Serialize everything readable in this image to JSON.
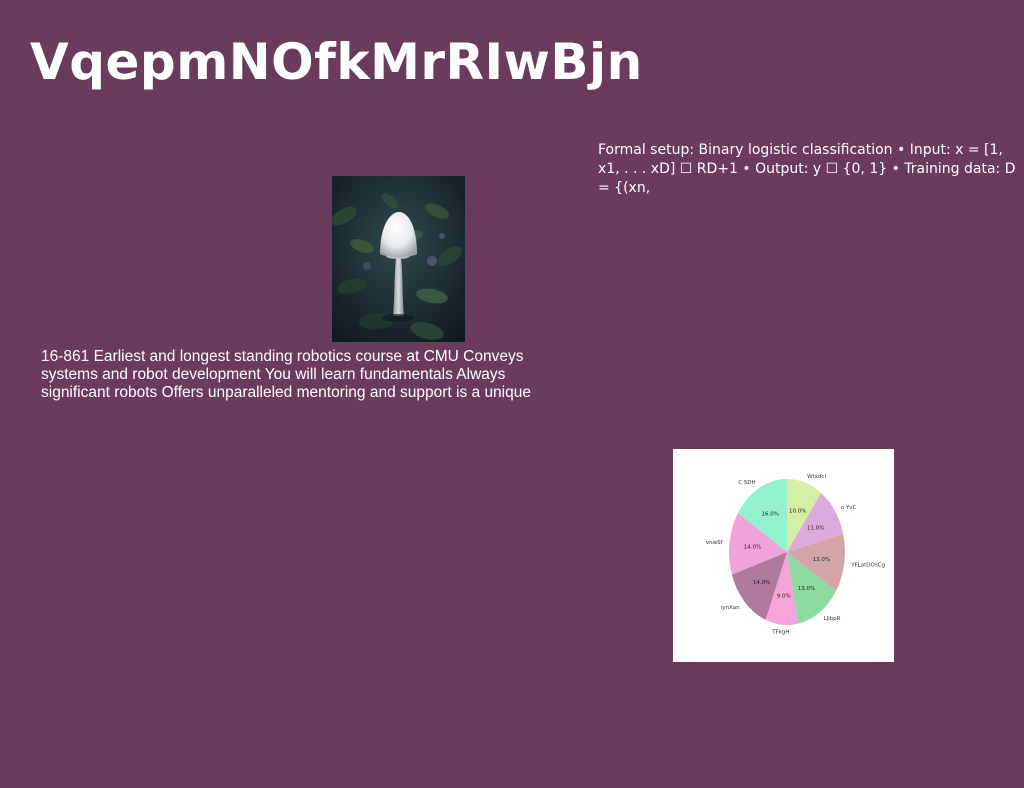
{
  "page": {
    "title": "VqepmNOfkMrRIwBjn",
    "background_color": "#6b3b5b"
  },
  "formal_setup": {
    "text": "Formal setup: Binary logistic classification • Input: x = [1, x1, . . . xD] ☐ RD+1 • Output: y ☐ {0, 1} • Training data: D = {(xn,"
  },
  "photo": {
    "subject": "white mushroom among dark foliage"
  },
  "course_description": {
    "text": "16-861 Earliest and longest standing robotics course at CMU Conveys systems and robot development You will learn fundamentals Always significant robots Offers unparalleled mentoring and support is a unique"
  },
  "chart_data": {
    "type": "pie",
    "title": "",
    "slices": [
      {
        "label": "Wtxdci",
        "value": 10.0,
        "display": "10.0%",
        "color": "#d4eea4"
      },
      {
        "label": "o YvC",
        "value": 11.0,
        "display": "11.0%",
        "color": "#ddaadd"
      },
      {
        "label": "YFLatDOsCg",
        "value": 13.0,
        "display": "13.0%",
        "color": "#d2a6a6"
      },
      {
        "label": "LjlbpR",
        "value": 13.0,
        "display": "13.0%",
        "color": "#8ddba0"
      },
      {
        "label": "TFkgH",
        "value": 9.0,
        "display": "9.0%",
        "color": "#f6a3da"
      },
      {
        "label": "iynXan",
        "value": 14.0,
        "display": "14.0%",
        "color": "#b07a9e"
      },
      {
        "label": "vnwSf",
        "value": 14.0,
        "display": "14.0%",
        "color": "#f0a3db"
      },
      {
        "label": "C SDH",
        "value": 16.0,
        "display": "16.0%",
        "color": "#93f2cd"
      }
    ],
    "start": "top, clockwise"
  }
}
